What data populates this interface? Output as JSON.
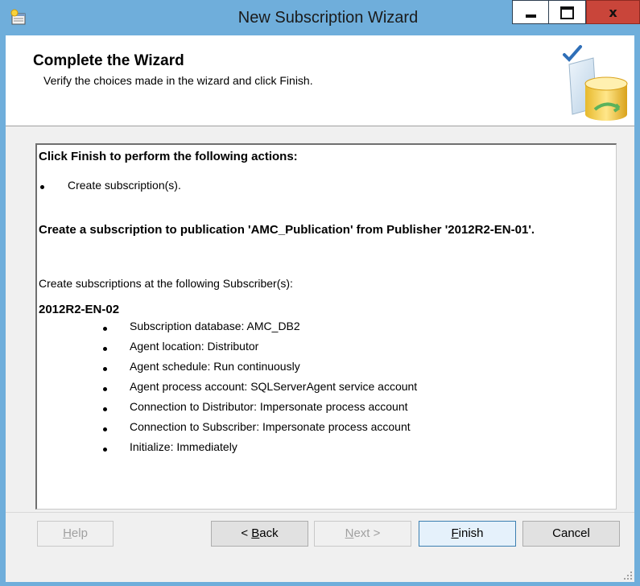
{
  "window": {
    "title": "New Subscription Wizard",
    "close_glyph": "x",
    "icons": [
      "wizard-app-icon",
      "minimize-icon",
      "maximize-icon",
      "close-icon"
    ]
  },
  "header": {
    "title": "Complete the Wizard",
    "subtitle": "Verify the choices made in the wizard and click Finish.",
    "graphic": "database-check-icon"
  },
  "summary": {
    "heading": "Click Finish to perform the following actions:",
    "actions": [
      "Create subscription(s)."
    ],
    "publication_heading": "Create a subscription to publication 'AMC_Publication' from Publisher '2012R2-EN-01'.",
    "subscriber_intro": "Create subscriptions at the following Subscriber(s):",
    "subscriber_name": "2012R2-EN-02",
    "details": [
      "Subscription database: AMC_DB2",
      "Agent location: Distributor",
      "Agent schedule: Run continuously",
      "Agent process account: SQLServerAgent service account",
      "Connection to Distributor: Impersonate process account",
      "Connection to Subscriber: Impersonate process account",
      "Initialize: Immediately"
    ]
  },
  "buttons": {
    "help": {
      "pre": "",
      "key": "H",
      "post": "elp"
    },
    "back": {
      "pre": "< ",
      "key": "B",
      "post": "ack"
    },
    "next": {
      "pre": "",
      "key": "N",
      "post": "ext >"
    },
    "finish": {
      "pre": "",
      "key": "F",
      "post": "inish"
    },
    "cancel": "Cancel"
  },
  "colors": {
    "frame": "#6faedb",
    "close_button": "#c9453a",
    "dialog_bg": "#f0f0f0"
  }
}
